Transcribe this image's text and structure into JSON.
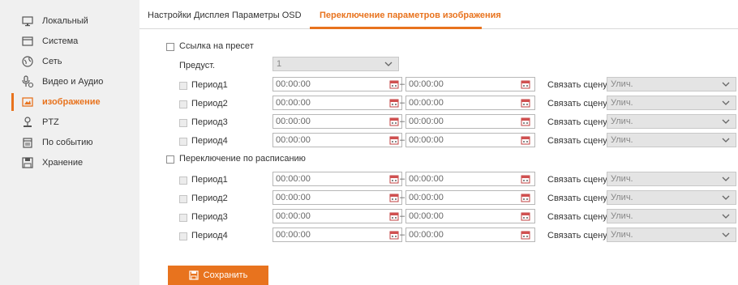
{
  "sidebar": {
    "items": [
      {
        "label": "Локальный",
        "icon": "monitor-icon"
      },
      {
        "label": "Система",
        "icon": "system-window-icon"
      },
      {
        "label": "Сеть",
        "icon": "network-globe-icon"
      },
      {
        "label": "Видео и Аудио",
        "icon": "video-audio-icon"
      },
      {
        "label": "изображение",
        "icon": "image-icon",
        "active": true
      },
      {
        "label": "PTZ",
        "icon": "ptz-icon"
      },
      {
        "label": "По событию",
        "icon": "event-calendar-icon"
      },
      {
        "label": "Хранение",
        "icon": "storage-save-icon"
      }
    ]
  },
  "tabs": [
    {
      "label": "Настройки Дисплея"
    },
    {
      "label": "Параметры OSD"
    },
    {
      "label": "Переключение параметров изображения",
      "active": true
    }
  ],
  "preset_section": {
    "checkbox_label": "Ссылка на пресет",
    "preset_label": "Предуст.",
    "preset_value": "1",
    "periods": [
      {
        "label": "Период1",
        "start": "00:00:00",
        "end": "00:00:00",
        "link_label": "Связать сцену",
        "scene": "Улич."
      },
      {
        "label": "Период2",
        "start": "00:00:00",
        "end": "00:00:00",
        "link_label": "Связать сцену",
        "scene": "Улич."
      },
      {
        "label": "Период3",
        "start": "00:00:00",
        "end": "00:00:00",
        "link_label": "Связать сцену",
        "scene": "Улич."
      },
      {
        "label": "Период4",
        "start": "00:00:00",
        "end": "00:00:00",
        "link_label": "Связать сцену",
        "scene": "Улич."
      }
    ]
  },
  "schedule_section": {
    "checkbox_label": "Переключение по расписанию",
    "periods": [
      {
        "label": "Период1",
        "start": "00:00:00",
        "end": "00:00:00",
        "link_label": "Связать сцену",
        "scene": "Улич."
      },
      {
        "label": "Период2",
        "start": "00:00:00",
        "end": "00:00:00",
        "link_label": "Связать сцену",
        "scene": "Улич."
      },
      {
        "label": "Период3",
        "start": "00:00:00",
        "end": "00:00:00",
        "link_label": "Связать сцену",
        "scene": "Улич."
      },
      {
        "label": "Период4",
        "start": "00:00:00",
        "end": "00:00:00",
        "link_label": "Связать сцену",
        "scene": "Улич."
      }
    ]
  },
  "save_button": {
    "label": "Сохранить",
    "icon": "floppy-disk-icon"
  },
  "colors": {
    "accent": "#e8731e",
    "sidebar_bg": "#f0f0f0"
  }
}
